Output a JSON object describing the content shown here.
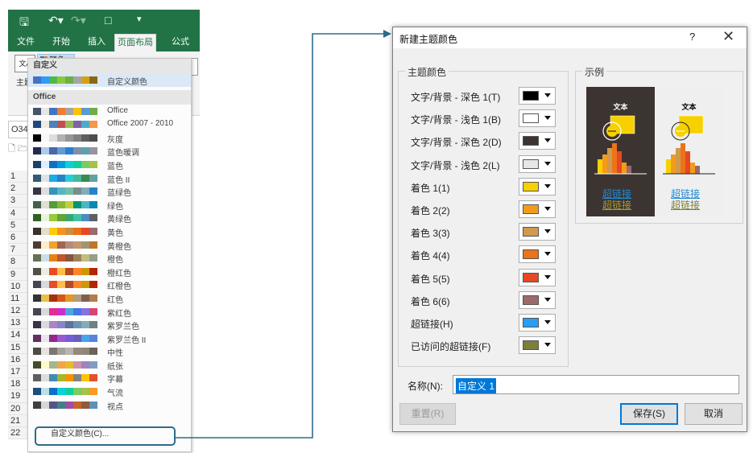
{
  "excel": {
    "tabs": [
      "文件",
      "开始",
      "插入",
      "页面布局",
      "公式"
    ],
    "active_tab": "页面布局",
    "theme_label": "主题",
    "colors_button": "颜色",
    "name_box": "O34",
    "row_numbers": [
      "1",
      "2",
      "3",
      "4",
      "5",
      "6",
      "7",
      "8",
      "9",
      "10",
      "11",
      "12",
      "13",
      "14",
      "15",
      "16",
      "17",
      "18",
      "19",
      "20",
      "21",
      "22"
    ],
    "dropdown": {
      "custom_section": "自定义",
      "custom_scheme": {
        "name": "自定义颜色",
        "colors": [
          "#4472c4",
          "#2a9df4",
          "#50b848",
          "#8cc63f",
          "#70ad47",
          "#a5a5a5",
          "#d4a017",
          "#8b6914"
        ]
      },
      "office_section": "Office",
      "schemes": [
        {
          "name": "Office",
          "colors": [
            "#44546a",
            "#e7e6e6",
            "#4472c4",
            "#ed7d31",
            "#a5a5a5",
            "#ffc000",
            "#5b9bd5",
            "#70ad47"
          ]
        },
        {
          "name": "Office 2007 - 2010",
          "colors": [
            "#1f497d",
            "#eeece1",
            "#4f81bd",
            "#c0504d",
            "#9bbb59",
            "#8064a2",
            "#4bacc6",
            "#f79646"
          ]
        },
        {
          "name": "灰度",
          "colors": [
            "#000000",
            "#f8f8f8",
            "#dddddd",
            "#b2b2b2",
            "#969696",
            "#808080",
            "#5f5f5f",
            "#4d4d4d"
          ]
        },
        {
          "name": "蓝色暖调",
          "colors": [
            "#242852",
            "#acccea",
            "#4a66ac",
            "#629dd1",
            "#297fd5",
            "#7f8fa9",
            "#5aa2ae",
            "#9d90a0"
          ]
        },
        {
          "name": "蓝色",
          "colors": [
            "#17406d",
            "#dbefff",
            "#0f6fc6",
            "#009dd9",
            "#0bd0d9",
            "#10cf9b",
            "#7cca62",
            "#a5c249"
          ]
        },
        {
          "name": "蓝色 II",
          "colors": [
            "#335b74",
            "#dfe3e5",
            "#1cade4",
            "#2683c6",
            "#27ced7",
            "#42ba97",
            "#3e8853",
            "#62a39f"
          ]
        },
        {
          "name": "蓝绿色",
          "colors": [
            "#373545",
            "#dedede",
            "#3494ba",
            "#58b6c0",
            "#75bda7",
            "#7a8c8e",
            "#84acb6",
            "#2683c6"
          ]
        },
        {
          "name": "绿色",
          "colors": [
            "#455f51",
            "#e3ded1",
            "#549e39",
            "#8ab833",
            "#c0cf3a",
            "#029676",
            "#4ab5c4",
            "#0989b1"
          ]
        },
        {
          "name": "黄绿色",
          "colors": [
            "#2f5f23",
            "#eaf2dd",
            "#99cb38",
            "#63a537",
            "#37a76f",
            "#44c1a3",
            "#4e88c6",
            "#5f5f5f"
          ]
        },
        {
          "name": "黄色",
          "colors": [
            "#39302a",
            "#e5dec9",
            "#ffca08",
            "#f8931d",
            "#ce8d3e",
            "#ec7016",
            "#e64823",
            "#9c6a6a"
          ]
        },
        {
          "name": "黄橙色",
          "colors": [
            "#4e3b30",
            "#fbeec9",
            "#f0a22e",
            "#a5644e",
            "#b58b80",
            "#c3986d",
            "#a19574",
            "#c17529"
          ]
        },
        {
          "name": "橙色",
          "colors": [
            "#637052",
            "#ccddea",
            "#e48312",
            "#bd582c",
            "#865640",
            "#9b8357",
            "#c2bc80",
            "#94a088"
          ]
        },
        {
          "name": "橙红色",
          "colors": [
            "#505046",
            "#eeece1",
            "#e84c22",
            "#ffbd47",
            "#b64926",
            "#ff8427",
            "#cc9900",
            "#b22600"
          ]
        },
        {
          "name": "红橙色",
          "colors": [
            "#454551",
            "#d8d9dc",
            "#e84c22",
            "#ffbd47",
            "#b64926",
            "#ff8427",
            "#cc9900",
            "#b22600"
          ]
        },
        {
          "name": "红色",
          "colors": [
            "#323232",
            "#e5c243",
            "#a5300f",
            "#d55816",
            "#e19825",
            "#b19c7d",
            "#7f5f52",
            "#b27d49"
          ]
        },
        {
          "name": "紫红色",
          "colors": [
            "#454551",
            "#d9d9d9",
            "#e32d91",
            "#c830cc",
            "#4ea6dc",
            "#4775e7",
            "#8971e1",
            "#d54773"
          ]
        },
        {
          "name": "紫罗兰色",
          "colors": [
            "#373545",
            "#dcd8dc",
            "#ad84c6",
            "#8784c7",
            "#5d739a",
            "#6997af",
            "#84acb6",
            "#6f8183"
          ]
        },
        {
          "name": "紫罗兰色 II",
          "colors": [
            "#632e62",
            "#eae5eb",
            "#92278f",
            "#9b57d3",
            "#755dd9",
            "#665eb8",
            "#45a5ed",
            "#5982db"
          ]
        },
        {
          "name": "中性",
          "colors": [
            "#4d4a47",
            "#e8e2dd",
            "#7b7471",
            "#a6a09c",
            "#b8b4ae",
            "#96897a",
            "#8e8777",
            "#6b625a"
          ]
        },
        {
          "name": "纸张",
          "colors": [
            "#444d26",
            "#fefac9",
            "#a5b592",
            "#f3a447",
            "#e7bc29",
            "#d092a7",
            "#9c85c0",
            "#809ec2"
          ]
        },
        {
          "name": "字幕",
          "colors": [
            "#5e5e5e",
            "#ddddde",
            "#418ab3",
            "#a6b727",
            "#f69200",
            "#838383",
            "#fec306",
            "#df5327"
          ]
        },
        {
          "name": "气流",
          "colors": [
            "#1d4c7f",
            "#bbe0e3",
            "#0f6fc6",
            "#0bd0d9",
            "#10cf9b",
            "#7cca62",
            "#a5c249",
            "#f89a28"
          ]
        },
        {
          "name": "视点",
          "colors": [
            "#3f3f3f",
            "#d7d7d7",
            "#53548a",
            "#438086",
            "#a04da3",
            "#c4652d",
            "#8b5d3d",
            "#5c92b5"
          ]
        }
      ],
      "custom_colors_item": "自定义颜色(C)..."
    }
  },
  "dialog": {
    "title": "新建主题颜色",
    "help": "?",
    "close": "✕",
    "theme_group": "主题颜色",
    "sample_group": "示例",
    "rows": [
      {
        "label": "文字/背景 - 深色 1(T)",
        "color": "#000000"
      },
      {
        "label": "文字/背景 - 浅色 1(B)",
        "color": "#ffffff"
      },
      {
        "label": "文字/背景 - 深色 2(D)",
        "color": "#3c3430"
      },
      {
        "label": "文字/背景 - 浅色 2(L)",
        "color": "#e6e6e6"
      },
      {
        "label": "着色 1(1)",
        "color": "#f7d000"
      },
      {
        "label": "着色 2(2)",
        "color": "#f39c1c"
      },
      {
        "label": "着色 3(3)",
        "color": "#d09a4e"
      },
      {
        "label": "着色 4(4)",
        "color": "#ee7219"
      },
      {
        "label": "着色 5(5)",
        "color": "#e64823"
      },
      {
        "label": "着色 6(6)",
        "color": "#9c6a6a"
      },
      {
        "label": "超链接(H)",
        "color": "#2a9df4"
      },
      {
        "label": "已访问的超链接(F)",
        "color": "#7d7d3c"
      }
    ],
    "sample": {
      "text_dark": "文本",
      "text_light": "文本",
      "hyperlink": "超链接",
      "visited_link": "超链接"
    },
    "name_label": "名称(N):",
    "name_value": "自定义 1",
    "reset_button": "重置(R)",
    "save_button": "保存(S)",
    "cancel_button": "取消"
  }
}
